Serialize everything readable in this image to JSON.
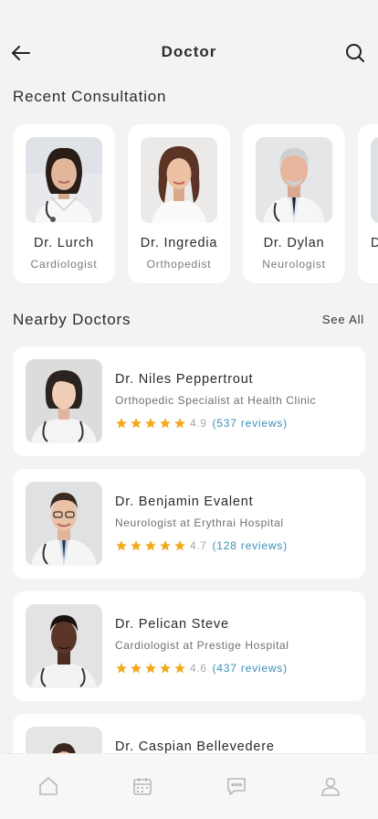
{
  "header": {
    "title": "Doctor",
    "back_icon": "arrow-left-icon",
    "search_icon": "search-icon"
  },
  "recent": {
    "title": "Recent Consultation",
    "cards": [
      {
        "name": "Dr. Lurch",
        "specialty": "Cardiologist"
      },
      {
        "name": "Dr. Ingredia",
        "specialty": "Orthopedist"
      },
      {
        "name": "Dr. Dylan",
        "specialty": "Neurologist"
      },
      {
        "name": "D",
        "specialty": ""
      }
    ]
  },
  "nearby": {
    "title": "Nearby Doctors",
    "see_all": "See All",
    "doctors": [
      {
        "name": "Dr. Niles Peppertrout",
        "specialty": "Orthopedic Specialist at Health Clinic",
        "rating": "4.9",
        "reviews": "(537 reviews)"
      },
      {
        "name": "Dr. Benjamin Evalent",
        "specialty": "Neurologist at Erythrai Hospital",
        "rating": "4.7",
        "reviews": "(128 reviews)"
      },
      {
        "name": "Dr. Pelican Steve",
        "specialty": "Cardiologist at Prestige Hospital",
        "rating": "4.6",
        "reviews": "(437 reviews)"
      },
      {
        "name": "Dr. Caspian Bellevedere",
        "specialty": "",
        "rating": "",
        "reviews": ""
      }
    ]
  },
  "bottom_nav": {
    "items": [
      "home-icon",
      "calendar-icon",
      "chat-icon",
      "profile-icon"
    ]
  },
  "colors": {
    "star": "#f2a91c",
    "reviews_link": "#3a8fb8",
    "background": "#f3f3f4",
    "card": "#ffffff"
  }
}
